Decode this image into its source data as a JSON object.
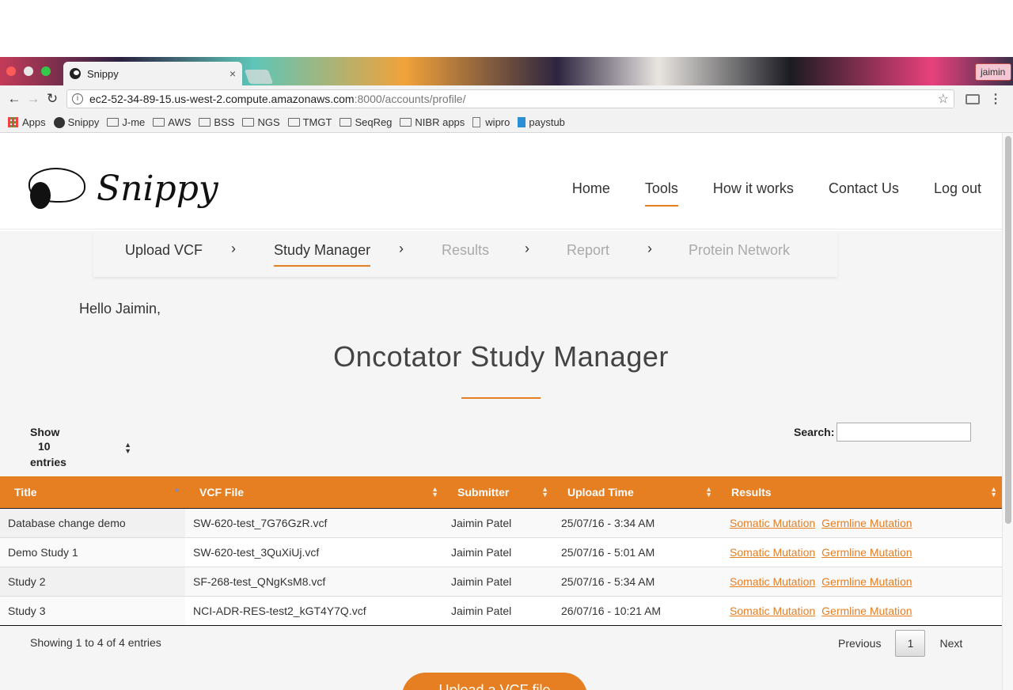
{
  "browser": {
    "tab_title": "Snippy",
    "tab_close": "×",
    "profile_name": "jaimin",
    "url_host": "ec2-52-34-89-15.us-west-2.compute.amazonaws.com",
    "url_path": ":8000/accounts/profile/",
    "bookmarks": [
      "Apps",
      "Snippy",
      "J-me",
      "AWS",
      "BSS",
      "NGS",
      "TMGT",
      "SeqReg",
      "NIBR apps",
      "wipro",
      "paystub"
    ]
  },
  "site": {
    "logo_text": "Snippy",
    "nav": [
      "Home",
      "Tools",
      "How it works",
      "Contact Us",
      "Log out"
    ],
    "active_nav": "Tools"
  },
  "steps": {
    "items": [
      "Upload VCF",
      "Study Manager",
      "Results",
      "Report",
      "Protein Network"
    ],
    "active": "Study Manager",
    "chevron": "›"
  },
  "greeting": "Hello Jaimin,",
  "page_title": "Oncotator Study Manager",
  "table_controls": {
    "show_label": "Show",
    "page_size": "10",
    "entries_label": "entries",
    "search_label": "Search:",
    "search_value": ""
  },
  "table": {
    "headers": [
      "Title",
      "VCF File",
      "Submitter",
      "Upload Time",
      "Results"
    ],
    "rows": [
      {
        "title": "Database change demo",
        "vcf": "SW-620-test_7G76GzR.vcf",
        "submitter": "Jaimin Patel",
        "time": "25/07/16 - 3:34 AM",
        "somatic": "Somatic Mutation",
        "germline": "Germline Mutation"
      },
      {
        "title": "Demo Study 1",
        "vcf": "SW-620-test_3QuXiUj.vcf",
        "submitter": "Jaimin Patel",
        "time": "25/07/16 - 5:01 AM",
        "somatic": "Somatic Mutation",
        "germline": "Germline Mutation"
      },
      {
        "title": "Study 2",
        "vcf": "SF-268-test_QNgKsM8.vcf",
        "submitter": "Jaimin Patel",
        "time": "25/07/16 - 5:34 AM",
        "somatic": "Somatic Mutation",
        "germline": "Germline Mutation"
      },
      {
        "title": "Study 3",
        "vcf": "NCI-ADR-RES-test2_kGT4Y7Q.vcf",
        "submitter": "Jaimin Patel",
        "time": "26/07/16 - 10:21 AM",
        "somatic": "Somatic Mutation",
        "germline": "Germline Mutation"
      }
    ]
  },
  "footer_info": "Showing 1 to 4 of 4 entries",
  "pager": {
    "previous": "Previous",
    "page": "1",
    "next": "Next"
  },
  "upload_button": "Upload a VCF file",
  "colors": {
    "accent": "#e67e22"
  }
}
